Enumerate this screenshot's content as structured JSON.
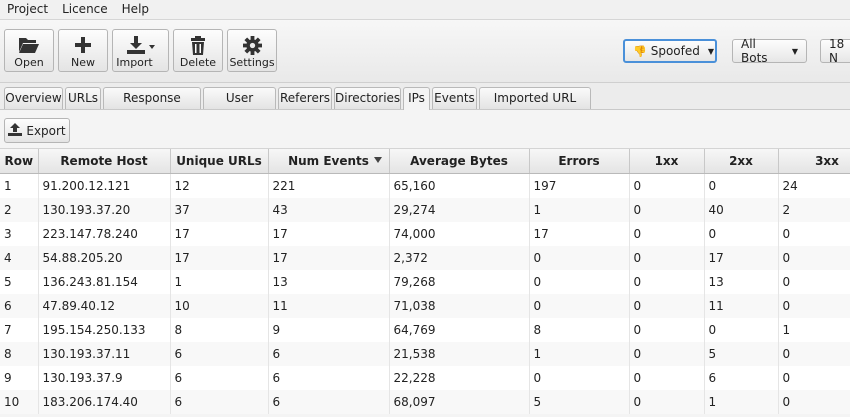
{
  "menu": [
    "Project",
    "Licence",
    "Help"
  ],
  "toolbar": {
    "open": "Open",
    "new": "New",
    "import": "Import",
    "delete": "Delete",
    "settings": "Settings",
    "spoofed": "Spoofed",
    "all_bots": "All Bots",
    "date_partial": "18 N"
  },
  "tabs": [
    "Overview",
    "URLs",
    "Response Codes",
    "User Agents",
    "Referers",
    "Directories",
    "IPs",
    "Events",
    "Imported URL Data"
  ],
  "active_tab": "IPs",
  "export_label": "Export",
  "table": {
    "columns": [
      "Row",
      "Remote Host",
      "Unique URLs",
      "Num Events",
      "Average Bytes",
      "Errors",
      "1xx",
      "2xx",
      "3xx"
    ],
    "sorted_column": "Num Events",
    "rows": [
      [
        "1",
        "91.200.12.121",
        "12",
        "221",
        "65,160",
        "197",
        "0",
        "0",
        "24"
      ],
      [
        "2",
        "130.193.37.20",
        "37",
        "43",
        "29,274",
        "1",
        "0",
        "40",
        "2"
      ],
      [
        "3",
        "223.147.78.240",
        "17",
        "17",
        "74,000",
        "17",
        "0",
        "0",
        "0"
      ],
      [
        "4",
        "54.88.205.20",
        "17",
        "17",
        "2,372",
        "0",
        "0",
        "17",
        "0"
      ],
      [
        "5",
        "136.243.81.154",
        "1",
        "13",
        "79,268",
        "0",
        "0",
        "13",
        "0"
      ],
      [
        "6",
        "47.89.40.12",
        "10",
        "11",
        "71,038",
        "0",
        "0",
        "11",
        "0"
      ],
      [
        "7",
        "195.154.250.133",
        "8",
        "9",
        "64,769",
        "8",
        "0",
        "0",
        "1"
      ],
      [
        "8",
        "130.193.37.11",
        "6",
        "6",
        "21,538",
        "1",
        "0",
        "5",
        "0"
      ],
      [
        "9",
        "130.193.37.9",
        "6",
        "6",
        "22,228",
        "0",
        "0",
        "6",
        "0"
      ],
      [
        "10",
        "183.206.174.40",
        "6",
        "6",
        "68,097",
        "5",
        "0",
        "1",
        "0"
      ]
    ]
  }
}
